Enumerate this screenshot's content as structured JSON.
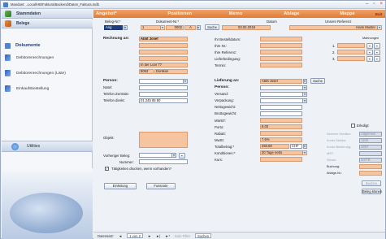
{
  "window": {
    "title": "Mandant: ..Local\\HB\\Faktura\\Backend\\Daten_Faktura.mdb"
  },
  "sidebar": {
    "stammdaten": "Stammdaten",
    "belege": "Belege",
    "section": "Dokumente",
    "items": [
      {
        "label": "Debitorenrechnungen"
      },
      {
        "label": "Debitorenrechnungen (Liste)"
      },
      {
        "label": "Einkaufsbestellung"
      }
    ],
    "utilities": "Utilities"
  },
  "tabs": {
    "angebot": "Angebot*",
    "positionen": "Positionen",
    "memo": "Memo",
    "ablage": "Ablage",
    "mappe": "Mappe",
    "exit": "Exit"
  },
  "header": {
    "beleg_nr_label": "Beleg-Nr.*",
    "beleg_nr_value": "Ang",
    "dokument_nr_label": "Dokument-Nr.*",
    "dok_a": "1",
    "dok_b": "0002",
    "dok_c": "A",
    "suche": "Suche",
    "datum_label": "Datum",
    "datum_value": "03.02.2018",
    "referenz_label": "Unsere Referenz",
    "referenz_value": "Hans Muster"
  },
  "rechnung": {
    "label": "Rechnung an:",
    "name": "Abbt Josef",
    "strasse": "In der Loor 77",
    "plz": "8053",
    "ort": "Dorlikon"
  },
  "bestell": {
    "bestelldatum": "Ihr Bestelldatum:",
    "ihre_nr": "Ihre Nr.:",
    "ihre_referenz": "Ihre Referenz:",
    "lieferbedingung": "Lieferbedingung:",
    "termin": "Termin:"
  },
  "mahnungen": {
    "label": "Mahnungen",
    "rows": [
      "1.",
      "2.",
      "3."
    ]
  },
  "person": {
    "person_label": "Person:",
    "natel_label": "Natel:",
    "telefon_zentrale_label": "Telefon Zentrale:",
    "telefon_direkt_label": "Telefon direkt:",
    "telefon_direkt_value": "01 245 65 80"
  },
  "lieferung": {
    "label": "Lieferung an:",
    "name": "Abbt Josef",
    "suche": "Suche",
    "person_label": "Person:",
    "versand": "Versand:",
    "verpackung": "Verpackung:",
    "nettogewicht": "Nettogewicht:",
    "bruttogewicht": "Bruttogewicht:"
  },
  "totals": {
    "mwst_label": "MWST:",
    "porto_label": "Porto:",
    "porto_value": "8.00",
    "rabatt_label": "Rabatt:",
    "mwst2_label": "MwSt:",
    "mwst2_value": "7.6%",
    "total_label": "Totalbetrag:*",
    "total_value": "493.80",
    "currency": "CHF",
    "konditionen_label": "Konditionen:*",
    "konditionen_value": "30 Tage netto",
    "kurs_label": "Kurs:"
  },
  "right": {
    "erledigt": "Erledigt",
    "erledigt_checked": false,
    "rows": [
      {
        "label": "Nummer Kreditor:",
        "value": "Allgemein"
      },
      {
        "label": "Konto Debitor:",
        "value": "1100"
      },
      {
        "label": "Konto Minderung:",
        "value": "3267"
      },
      {
        "label": "MST:",
        "value": ""
      },
      {
        "label": "Steuer:",
        "value": "GSTR"
      },
      {
        "label": "Buchung:",
        "value": ""
      },
      {
        "label": "Ablage-Nr.:",
        "value": ""
      }
    ],
    "buchen": "Buchen",
    "beleg_kopieren": "Beleg klonen"
  },
  "objekt": {
    "label": "Objekt:"
  },
  "vorheriger": {
    "label": "Vorheriger Beleg:",
    "nummer_label": "Nummer:",
    "taetigkeiten": "Tätigkeiten drucken, wenn vorhanden?",
    "taetigkeiten_checked": true
  },
  "footer": {
    "einleitung": "Einleitung",
    "fussnote": "Fussnote"
  },
  "status": {
    "record": "Datensatz:",
    "position": "1 von 2",
    "filter": "Kein Filter",
    "search": "Suchen"
  }
}
